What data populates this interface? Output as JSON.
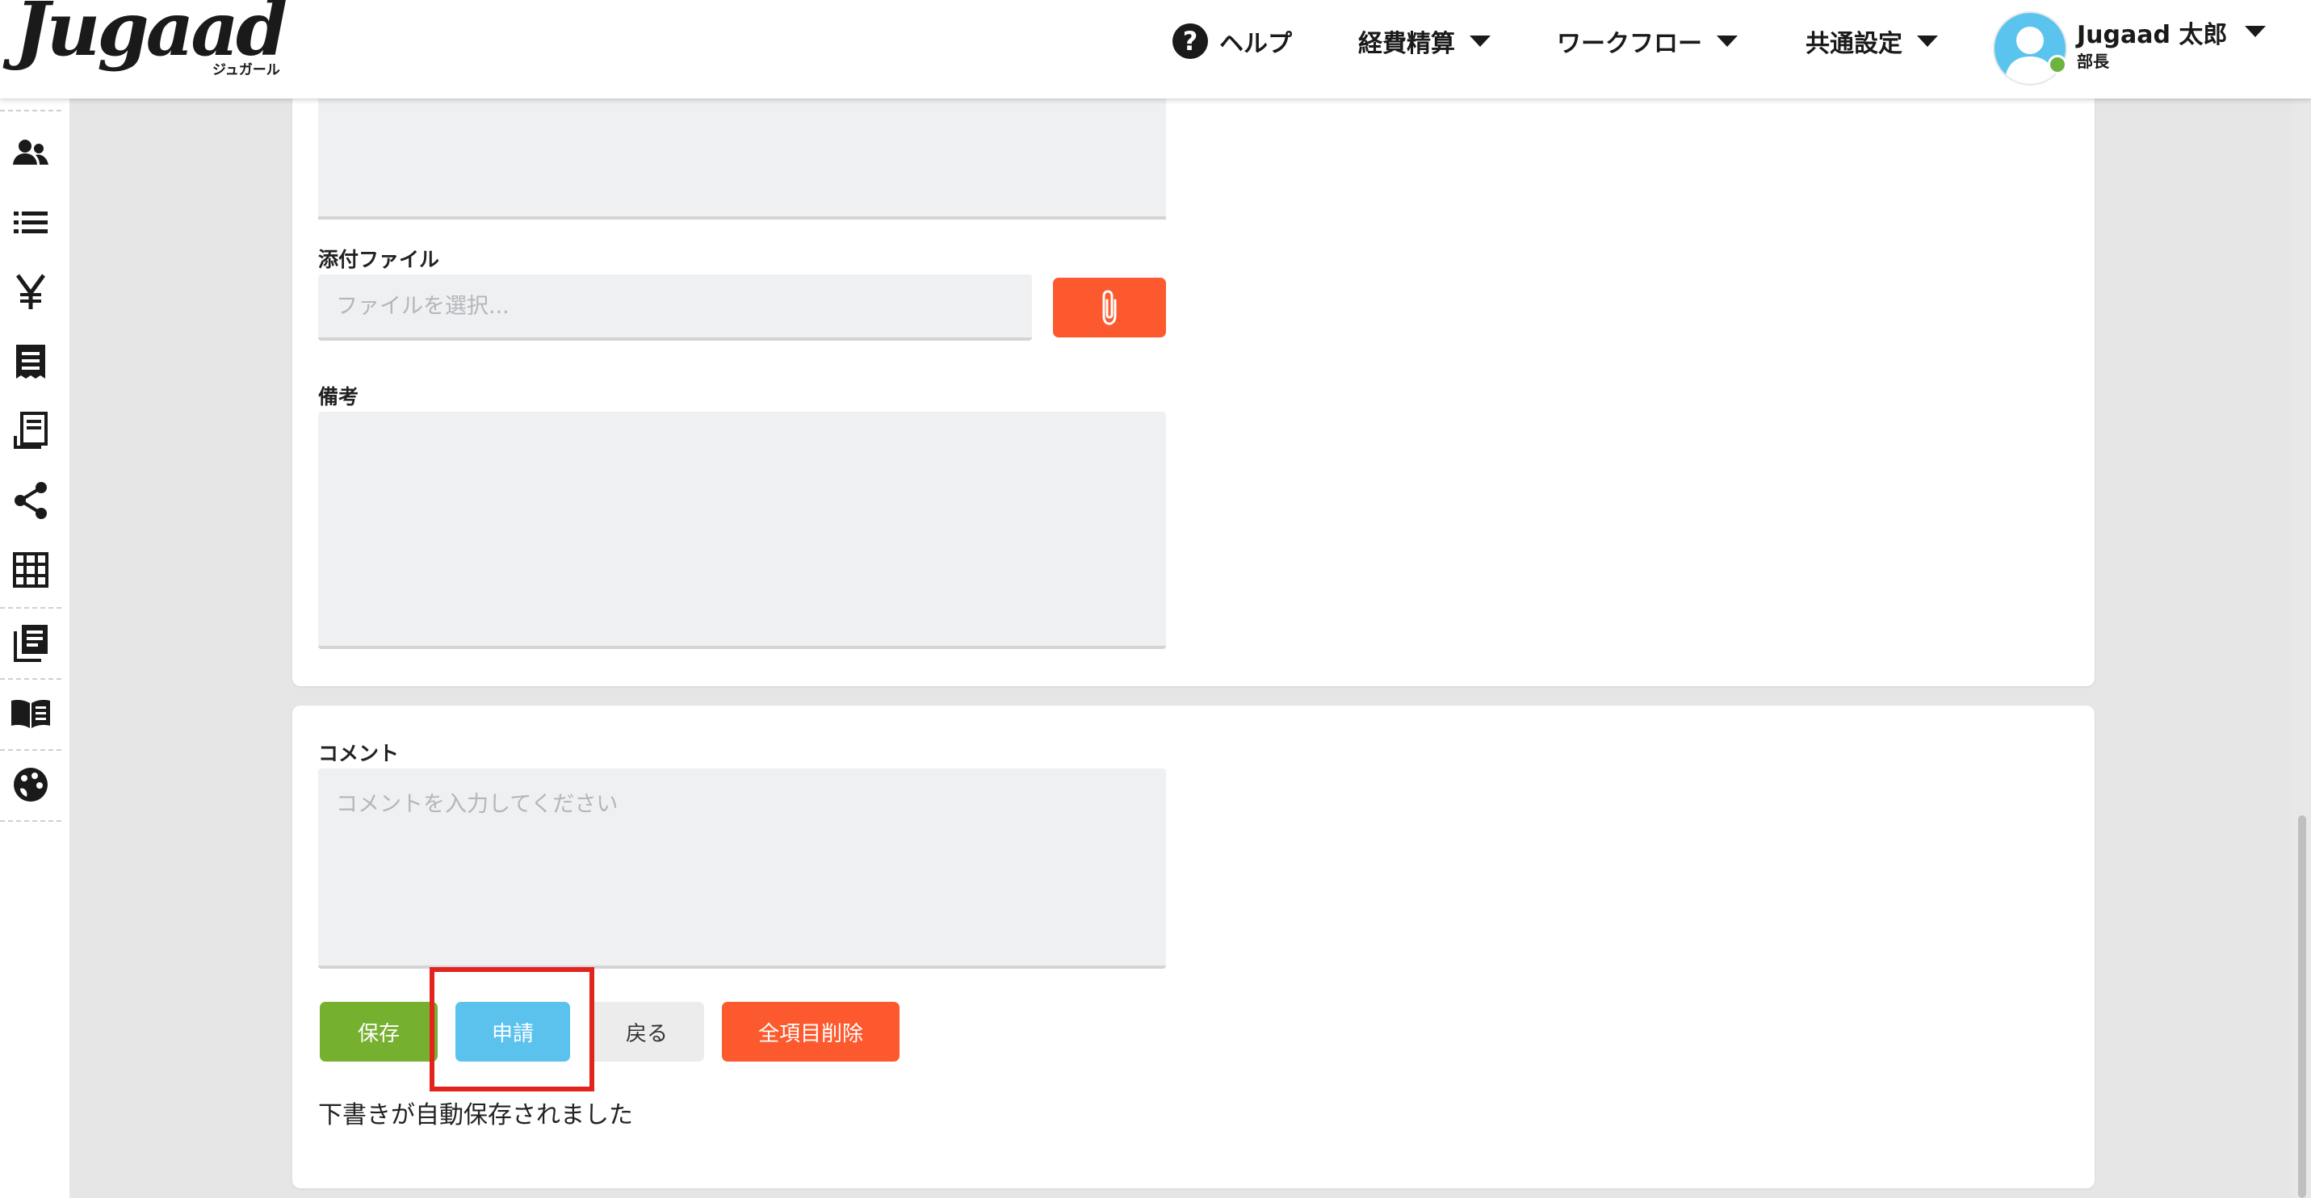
{
  "header": {
    "logo_text": "Jugaad",
    "logo_sub": "ジュガール",
    "nav": {
      "help": "ヘルプ",
      "expense": "経費精算",
      "workflow": "ワークフロー",
      "settings": "共通設定"
    },
    "user": {
      "name": "Jugaad 太郎",
      "role": "部長"
    }
  },
  "sidebar": {
    "icons": [
      "users-icon",
      "list-icon",
      "yen-icon",
      "receipt-icon",
      "invoice-icon",
      "share-icon",
      "grid-icon",
      "library-icon",
      "book-icon",
      "palette-icon"
    ]
  },
  "form": {
    "attachment_label": "添付ファイル",
    "attachment_placeholder": "ファイルを選択...",
    "remarks_label": "備考",
    "remarks_value": ""
  },
  "comment": {
    "label": "コメント",
    "placeholder": "コメントを入力してください",
    "buttons": {
      "save": "保存",
      "apply": "申請",
      "back": "戻る",
      "clear_all": "全項目削除"
    },
    "autosave_message": "下書きが自動保存されました"
  },
  "colors": {
    "save": "#76b02f",
    "apply": "#5bc2ee",
    "back": "#ececec",
    "danger": "#fc5a2e",
    "accent": "#6fc3ec",
    "highlight": "#e3241e"
  }
}
